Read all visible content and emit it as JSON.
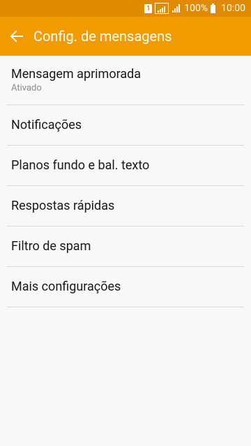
{
  "status_bar": {
    "sim_number": "1",
    "battery_percent": "100%",
    "time": "10:00"
  },
  "app_bar": {
    "title": "Config. de mensagens"
  },
  "settings": {
    "items": [
      {
        "label": "Mensagem aprimorada",
        "sublabel": "Ativado"
      },
      {
        "label": "Notificações"
      },
      {
        "label": "Planos fundo e bal. texto"
      },
      {
        "label": "Respostas rápidas"
      },
      {
        "label": "Filtro de spam"
      },
      {
        "label": "Mais configurações"
      }
    ]
  }
}
